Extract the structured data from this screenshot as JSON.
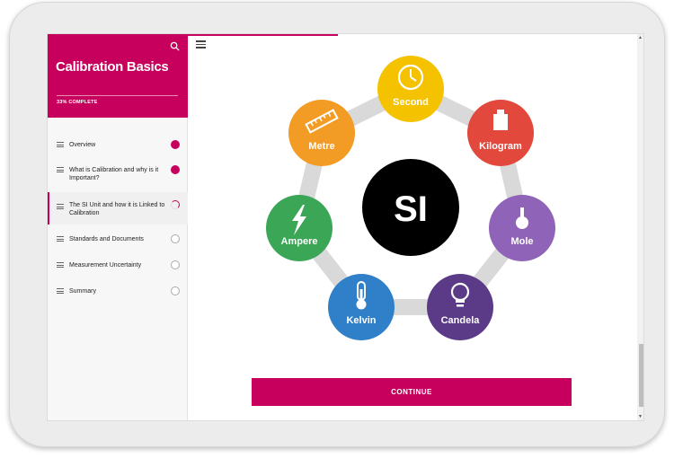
{
  "course": {
    "title": "Calibration Basics",
    "progress_text": "33% COMPLETE"
  },
  "nav": [
    {
      "label": "Overview",
      "status": "done"
    },
    {
      "label": "What is Calibration and why is it Important?",
      "status": "done"
    },
    {
      "label": "The SI Unit and how it is Linked to Calibration",
      "status": "in-progress"
    },
    {
      "label": "Standards and Documents",
      "status": "todo"
    },
    {
      "label": "Measurement Uncertainty",
      "status": "todo"
    },
    {
      "label": "Summary",
      "status": "todo"
    }
  ],
  "diagram": {
    "center_label": "SI",
    "units": [
      {
        "label": "Second",
        "color": "#f5c200",
        "icon": "clock-icon"
      },
      {
        "label": "Kilogram",
        "color": "#e2483c",
        "icon": "weight-icon"
      },
      {
        "label": "Mole",
        "color": "#8f64b8",
        "icon": "flask-icon"
      },
      {
        "label": "Candela",
        "color": "#5b3a87",
        "icon": "lightbulb-icon"
      },
      {
        "label": "Kelvin",
        "color": "#2f80c9",
        "icon": "thermometer-icon"
      },
      {
        "label": "Ampere",
        "color": "#3aa656",
        "icon": "lightning-icon"
      },
      {
        "label": "Metre",
        "color": "#f29b25",
        "icon": "ruler-icon"
      }
    ]
  },
  "continue_label": "CONTINUE",
  "colors": {
    "accent": "#c6005c"
  }
}
